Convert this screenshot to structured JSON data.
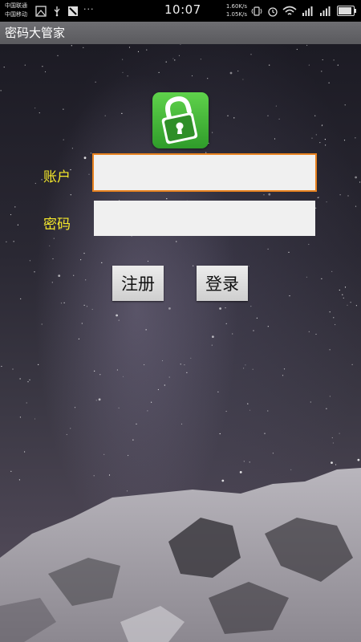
{
  "status_bar": {
    "carrier_1": "中国联通",
    "carrier_2": "中国移动",
    "time": "10:07",
    "speed_up": "1.60K/s",
    "speed_down": "1.05K/s",
    "icons": [
      "image-icon",
      "usb-icon",
      "flag-icon",
      "more-dots-icon",
      "vibrate-icon",
      "alarm-icon",
      "wifi-icon",
      "signal-icon",
      "signal-icon",
      "battery-icon"
    ],
    "dots": "···",
    "battery_level": 0.9
  },
  "app": {
    "title": "密码大管家"
  },
  "login": {
    "account_label": "账户",
    "password_label": "密码",
    "account_value": "",
    "password_value": "",
    "register_label": "注册",
    "login_label": "登录"
  },
  "colors": {
    "label": "#f5e92a",
    "focus_border": "#e8821f",
    "icon_green": "#3fb232"
  }
}
